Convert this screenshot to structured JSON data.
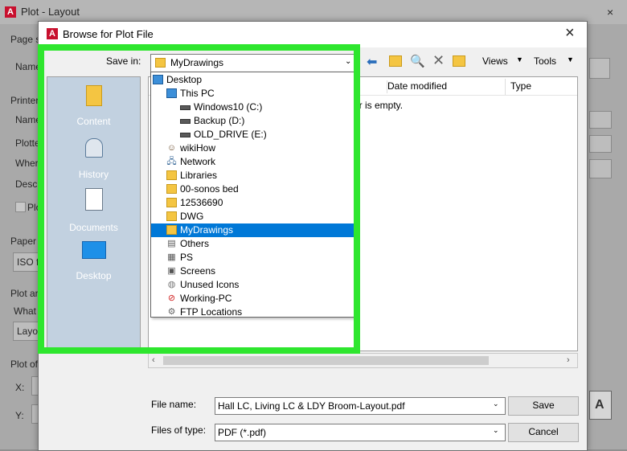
{
  "background_window": {
    "title": "Plot - Layout",
    "labels": [
      "Page s",
      "Name",
      "Printer",
      "Name",
      "Plotte",
      "Where",
      "Descr",
      "Plo",
      "Paper",
      "ISO f",
      "Plot ar",
      "What",
      "Layo",
      "Plot off",
      "X:",
      "Y:"
    ]
  },
  "dialog": {
    "title": "Browse for Plot File",
    "close_glyph": "×",
    "save_in_label": "Save in:",
    "save_in_value": "MyDrawings",
    "toolbar": {
      "views_label": "Views",
      "tools_label": "Tools"
    },
    "places": [
      {
        "label": "Content",
        "icon": "folder-icon"
      },
      {
        "label": "History",
        "icon": "history-icon"
      },
      {
        "label": "Documents",
        "icon": "documents-icon"
      },
      {
        "label": "Desktop",
        "icon": "desktop-icon"
      }
    ],
    "columns": {
      "date_modified": "Date modified",
      "type": "Type"
    },
    "empty_text": "er is empty.",
    "dropdown_items": [
      {
        "label": "Desktop",
        "icon": "computer",
        "indent": 0,
        "selected": false
      },
      {
        "label": "This PC",
        "icon": "computer",
        "indent": 1,
        "selected": false
      },
      {
        "label": "Windows10 (C:)",
        "icon": "drive",
        "indent": 2,
        "selected": false
      },
      {
        "label": "Backup (D:)",
        "icon": "drive",
        "indent": 2,
        "selected": false
      },
      {
        "label": "OLD_DRIVE (E:)",
        "icon": "drive",
        "indent": 2,
        "selected": false
      },
      {
        "label": "wikiHow",
        "icon": "user",
        "indent": 1,
        "selected": false
      },
      {
        "label": "Network",
        "icon": "network",
        "indent": 1,
        "selected": false
      },
      {
        "label": "Libraries",
        "icon": "folder",
        "indent": 1,
        "selected": false
      },
      {
        "label": "00-sonos bed",
        "icon": "folder",
        "indent": 1,
        "selected": false
      },
      {
        "label": "12536690",
        "icon": "folder",
        "indent": 1,
        "selected": false
      },
      {
        "label": "DWG",
        "icon": "folder",
        "indent": 1,
        "selected": false
      },
      {
        "label": "MyDrawings",
        "icon": "folder",
        "indent": 1,
        "selected": true
      },
      {
        "label": "Others",
        "icon": "others",
        "indent": 1,
        "selected": false
      },
      {
        "label": "PS",
        "icon": "ps",
        "indent": 1,
        "selected": false
      },
      {
        "label": "Screens",
        "icon": "screens",
        "indent": 1,
        "selected": false
      },
      {
        "label": "Unused Icons",
        "icon": "unused",
        "indent": 1,
        "selected": false
      },
      {
        "label": "Working-PC",
        "icon": "blocked",
        "indent": 1,
        "selected": false
      },
      {
        "label": "FTP Locations",
        "icon": "ftp",
        "indent": 1,
        "selected": false
      }
    ],
    "file_name_label": "File name:",
    "file_name_value": "Hall LC, Living LC & LDY Broom-Layout.pdf",
    "files_of_type_label": "Files of type:",
    "files_of_type_value": "PDF (*.pdf)",
    "save_button": "Save",
    "cancel_button": "Cancel"
  },
  "colors": {
    "highlight": "#2ee62e",
    "selection": "#0078d7",
    "places_bg": "#c2d1e0"
  }
}
